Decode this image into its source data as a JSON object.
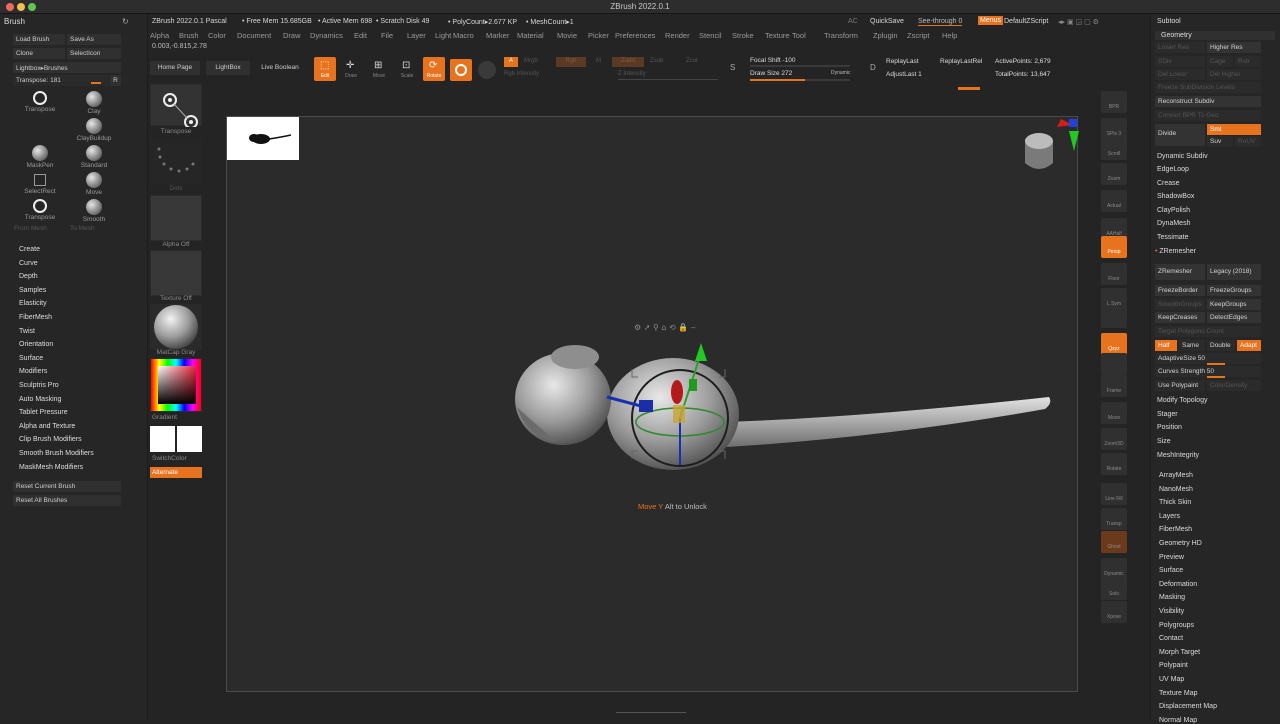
{
  "app_title": "ZBrush 2022.0.1",
  "infobar": {
    "version": "ZBrush 2022.0.1 Pascal",
    "free_mem": "• Free Mem 15.685GB",
    "active_mem": "• Active Mem 698",
    "scratch": "• Scratch Disk 49",
    "polycount": "• PolyCount▸2.677 KP",
    "meshcount": "• MeshCount▸1",
    "ac": "AC",
    "quicksave": "QuickSave",
    "seethrough": "See-through  0",
    "menus": "Menus",
    "defaultzscript": "DefaultZScript"
  },
  "menus": [
    "Alpha",
    "Brush",
    "Color",
    "Document",
    "Draw",
    "Dynamics",
    "Edit",
    "File",
    "Layer",
    "Light",
    "Macro",
    "Marker",
    "Material",
    "Movie",
    "Picker",
    "Preferences",
    "Render",
    "Stencil",
    "Stroke",
    "Texture",
    "Tool",
    "Transform",
    "Zplugin",
    "Zscript",
    "Help"
  ],
  "coords": "0.003,-0.815,2.78",
  "brush_panel": {
    "title": "Brush",
    "load_brush": "Load Brush",
    "save_as": "Save As",
    "clone": "Clone",
    "select_icon": "SelectIcon",
    "lightbox_brushes": "Lightbox▸Brushes",
    "transpose_value": "Transpose: 181",
    "r": "R",
    "brushes": [
      {
        "label": "Transpose",
        "kind": "transpose"
      },
      {
        "label": "Clay",
        "kind": "ball"
      },
      {
        "label": "ClayBuildup",
        "kind": "ball"
      },
      {
        "label": "MaskPen",
        "kind": "ball"
      },
      {
        "label": "Standard",
        "kind": "ball"
      },
      {
        "label": "SelectRect",
        "kind": "square"
      },
      {
        "label": "Move",
        "kind": "ball"
      },
      {
        "label": "Transpose",
        "kind": "transpose"
      },
      {
        "label": "Smooth",
        "kind": "ball"
      }
    ],
    "from_mesh": "From Mesh",
    "to_mesh": "To Mesh",
    "items": [
      "Create",
      "Curve",
      "Depth",
      "Samples",
      "Elasticity",
      "FiberMesh",
      "Twist",
      "Orientation",
      "Surface",
      "Modifiers",
      "Sculptris Pro",
      "Auto Masking",
      "Tablet Pressure",
      "Alpha and Texture",
      "Clip Brush Modifiers",
      "Smooth Brush Modifiers",
      "MaskMesh Modifiers"
    ],
    "reset_current": "Reset Current Brush",
    "reset_all": "Reset All Brushes"
  },
  "col2": {
    "transpose": "Transpose",
    "dots": "Dots",
    "alpha_off": "Alpha Off",
    "texture_off": "Texture Off",
    "matcap": "MatCap Gray",
    "gradient": "Gradient",
    "switchcolor": "SwitchColor",
    "alternate": "Alternate"
  },
  "toolbar": {
    "home_page": "Home Page",
    "lightbox": "LightBox",
    "live_boolean": "Live Boolean",
    "edit": "Edit",
    "draw": "Draw",
    "move": "Move",
    "scale": "Scale",
    "rotate": "Rotate",
    "a": "A",
    "mrgb": "Mrgb",
    "rgb": "Rgb",
    "m": "M",
    "zadd": "Zadd",
    "zsub": "Zsub",
    "zcut": "Zcut",
    "rgb_intensity": "Rgb Intensity",
    "z_intensity": "Z Intensity",
    "focal_shift": "Focal Shift -100",
    "draw_size": "Draw Size 272",
    "dynamic": "Dynamic",
    "replay_last": "ReplayLast",
    "replay_last_rel": "ReplayLastRel",
    "adjust_last": "AdjustLast 1",
    "active_points": "ActivePoints: 2,679",
    "total_points": "TotalPoints: 13,647",
    "focal_fraction": 0.0,
    "drawsize_fraction": 0.55
  },
  "canvas": {
    "status_move": "Move Y",
    "status_rest": "Alt to Unlock"
  },
  "right_shelf": [
    "BPR",
    "SPix 3",
    "Scroll",
    "Zoom",
    "Actual",
    "AAHalf",
    "Persp",
    "Floor",
    "L.Sym",
    "",
    "Qxyz",
    "",
    "Frame",
    "Move",
    "Zoom3D",
    "Rotate",
    "Line Fill",
    "Transp",
    "Ghost",
    "Dynamic",
    "Solo",
    "Xpose"
  ],
  "spix": "SPix 3",
  "right_panel": {
    "subtool": "Subtool",
    "geometry": "Geometry",
    "lower_res": "Lower Res",
    "higher_res": "Higher Res",
    "sdiv": "SDiv",
    "cage": "Cage",
    "rstr": "Rstr",
    "del_lower": "Del Lower",
    "del_higher": "Del Higher",
    "freeze_subdiv": "Freeze SubDivision Levels",
    "reconstruct": "Reconstruct Subdiv",
    "convert_bpr": "Convert BPR To Geo",
    "divide": "Divide",
    "smt": "Smt",
    "suv": "Suv",
    "reuv": "ReUV",
    "dynamic_subdiv": "Dynamic Subdiv",
    "edgeloop": "EdgeLoop",
    "crease": "Crease",
    "shadowbox": "ShadowBox",
    "claypolish": "ClayPolish",
    "dynamesh": "DynaMesh",
    "tessimate": "Tessimate",
    "zremesher": "ZRemesher",
    "zremesher_btn": "ZRemesher",
    "legacy": "Legacy (2018)",
    "freezeborder": "FreezeBorder",
    "freezegroups": "FreezeGroups",
    "smoothgroups": "SmoothGroups",
    "keepgroups": "KeepGroups",
    "keepcreases": "KeepCreases",
    "detectedges": "DetectEdges",
    "target_polygons": "Target Polygons Count",
    "half": "Half",
    "same": "Same",
    "double": "Double",
    "adapt": "Adapt",
    "adaptive_size": "AdaptiveSize 50",
    "curves_strength": "Curves Strength 50",
    "use_polypaint": "Use Polypaint",
    "color_density": "ColorDensity",
    "modify_topology": "Modify Topology",
    "stager": "Stager",
    "position": "Position",
    "size": "Size",
    "meshintegrity": "MeshIntegrity",
    "sections": [
      "ArrayMesh",
      "NanoMesh",
      "Thick Skin",
      "Layers",
      "FiberMesh",
      "Geometry HD",
      "Preview",
      "Surface",
      "Deformation",
      "Masking",
      "Visibility",
      "Polygroups",
      "Contact",
      "Morph Target",
      "Polypaint",
      "UV Map",
      "Texture Map",
      "Displacement Map",
      "Normal Map"
    ]
  },
  "colors": {
    "accent": "#e8731e",
    "bg": "#242424",
    "canvas": "#2b2b2b"
  }
}
